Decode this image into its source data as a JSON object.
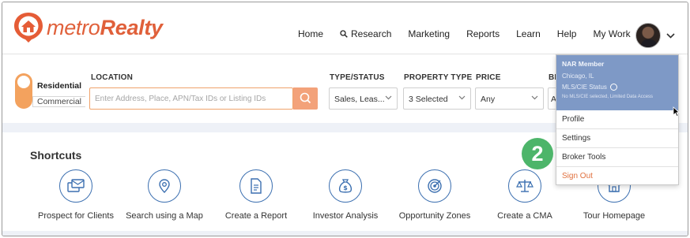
{
  "brand": {
    "name_light": "metro",
    "name_bold": "Realty",
    "color": "#e0603a"
  },
  "nav": {
    "items": [
      {
        "label": "Home",
        "icon": ""
      },
      {
        "label": "Research",
        "icon": "search-icon"
      },
      {
        "label": "Marketing",
        "icon": ""
      },
      {
        "label": "Reports",
        "icon": ""
      },
      {
        "label": "Learn",
        "icon": ""
      },
      {
        "label": "Help",
        "icon": ""
      },
      {
        "label": "My Work",
        "icon": ""
      }
    ]
  },
  "search": {
    "mode_residential": "Residential",
    "mode_commercial": "Commercial",
    "location_label": "LOCATION",
    "location_placeholder": "Enter Address, Place, APN/Tax IDs or Listing IDs",
    "type_status_label": "TYPE/STATUS",
    "type_status_value": "Sales, Leas...",
    "property_type_label": "PROPERTY TYPE",
    "property_type_value": "3 Selected",
    "price_label": "PRICE",
    "price_value": "Any",
    "beds_label_partial": "BE",
    "beds_value_partial": "A"
  },
  "shortcuts": {
    "title": "Shortcuts",
    "items": [
      {
        "label": "Prospect for Clients",
        "icon": "mail-card-icon"
      },
      {
        "label": "Search using a Map",
        "icon": "map-pin-search-icon"
      },
      {
        "label": "Create a Report",
        "icon": "document-icon"
      },
      {
        "label": "Investor Analysis",
        "icon": "money-bag-icon"
      },
      {
        "label": "Opportunity Zones",
        "icon": "target-icon"
      },
      {
        "label": "Create a CMA",
        "icon": "scales-icon"
      },
      {
        "label": "Tour Homepage",
        "icon": "home-icon"
      }
    ]
  },
  "user_menu": {
    "member_type": "NAR Member",
    "location": "Chicago, IL",
    "mls_status": "MLS/CIE Status",
    "mls_note": "No MLS/CIE selected, Limited Data Access",
    "items": [
      "Profile",
      "Settings",
      "Broker Tools"
    ],
    "signout": "Sign Out",
    "header_color": "#7e99c6"
  },
  "callout": {
    "number": "2",
    "color": "#4db56a"
  }
}
